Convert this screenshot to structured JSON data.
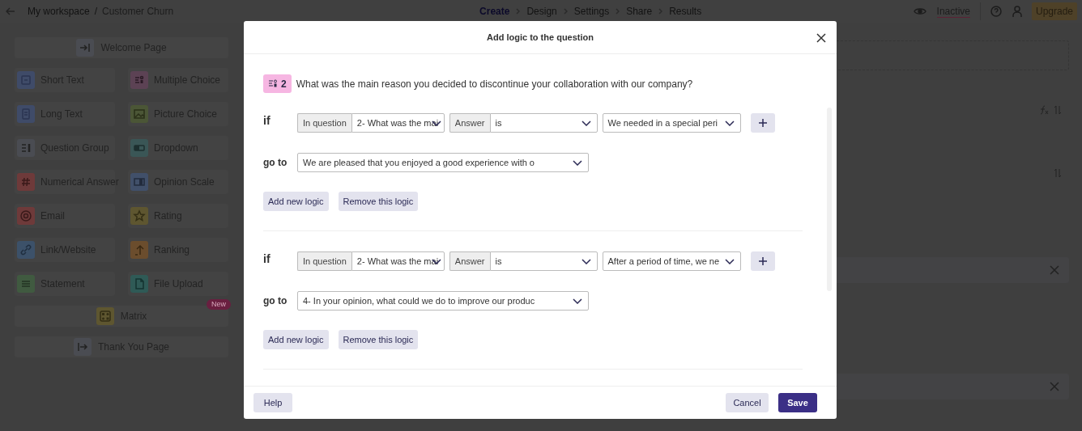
{
  "breadcrumb": {
    "workspace": "My workspace",
    "separator": "/",
    "form": "Customer Churn"
  },
  "steps": [
    {
      "label": "Create",
      "selected": true
    },
    {
      "label": "Design",
      "selected": false
    },
    {
      "label": "Settings",
      "selected": false
    },
    {
      "label": "Share",
      "selected": false
    },
    {
      "label": "Results",
      "selected": false
    }
  ],
  "status": "Inactive",
  "upgrade": "Upgrade",
  "sidebar": {
    "items": [
      {
        "label": "Welcome Page",
        "kind": "wide",
        "color": "#4a4c52"
      },
      {
        "label": "Short Text",
        "kind": "tile",
        "color": "#3f4b68"
      },
      {
        "label": "Multiple Choice",
        "kind": "tile",
        "color": "#5c4254"
      },
      {
        "label": "Long Text",
        "kind": "tile",
        "color": "#3f4b68"
      },
      {
        "label": "Picture Choice",
        "kind": "tile",
        "color": "#4b5636"
      },
      {
        "label": "Question Group",
        "kind": "tile",
        "color": "#4a4c52"
      },
      {
        "label": "Dropdown",
        "kind": "tile",
        "color": "#3a5656"
      },
      {
        "label": "Numerical Answer",
        "kind": "tile",
        "color": "#6e3a3a"
      },
      {
        "label": "Opinion Scale",
        "kind": "tile",
        "color": "#41506a"
      },
      {
        "label": "Email",
        "kind": "tile",
        "color": "#6e3a3a"
      },
      {
        "label": "Rating",
        "kind": "tile",
        "color": "#5e5630"
      },
      {
        "label": "Link/Website",
        "kind": "tile",
        "color": "#3c5169"
      },
      {
        "label": "Ranking",
        "kind": "tile",
        "color": "#6b4d2d"
      },
      {
        "label": "Statement",
        "kind": "tile",
        "color": "#405a40"
      },
      {
        "label": "File Upload",
        "kind": "tile",
        "color": "#2f5a56"
      },
      {
        "label": "Matrix",
        "kind": "wide",
        "color": "#5e5630",
        "badge": "New"
      },
      {
        "label": "Thank You Page",
        "kind": "wide",
        "color": "#4a4c52"
      }
    ]
  },
  "modal": {
    "title": "Add logic to the question",
    "question": {
      "number": "2",
      "text": "What was the main reason you decided to discontinue your collaboration with our company?"
    },
    "rules": [
      {
        "if_label": "if",
        "question_label": "In question",
        "question": "2- What was the mai",
        "answer_label": "Answer",
        "operator": "is",
        "value": "We needed in a special peri",
        "goto_label": "go to",
        "goto": "We are pleased that you enjoyed a good experience with o",
        "add": "Add new logic",
        "remove": "Remove this logic"
      },
      {
        "if_label": "if",
        "question_label": "In question",
        "question": "2- What was the mai",
        "answer_label": "Answer",
        "operator": "is",
        "value": "After a period of time, we ne",
        "goto_label": "go to",
        "goto": "4- In your opinion, what could we do to improve our produc",
        "add": "Add new logic",
        "remove": "Remove this logic"
      }
    ],
    "help": "Help",
    "cancel": "Cancel",
    "save": "Save"
  }
}
